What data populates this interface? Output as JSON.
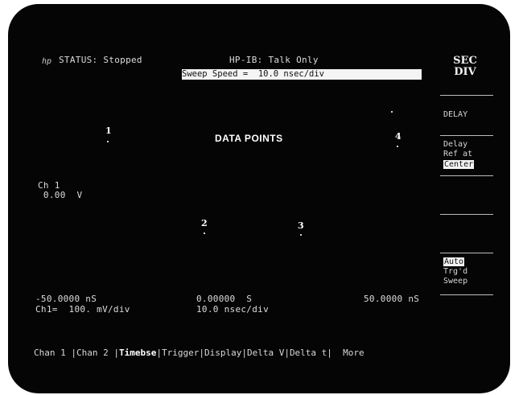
{
  "header": {
    "logo": "hp",
    "status": "STATUS: Stopped",
    "hpib": "HP-IB: Talk Only",
    "sweep_speed": "Sweep Speed =  10.0 nsec/div"
  },
  "softkeys": {
    "title_line1": "SEC",
    "title_line2": "DIV",
    "delay": "DELAY",
    "delay_ref_line1": "Delay",
    "delay_ref_line2": "Ref at",
    "delay_ref_line3": "Center",
    "mode_line1": "Auto",
    "mode_line2": "Trg'd",
    "mode_line3": "Sweep"
  },
  "overlay": {
    "title": "DATA POINTS",
    "markers": [
      "1",
      "2",
      "3",
      "4"
    ]
  },
  "channel": {
    "label": "Ch 1",
    "offset": " 0.00  V"
  },
  "timebase": {
    "left": "-50.0000 nS",
    "center": "0.00000  S",
    "right": "50.0000 nS",
    "ch1_scale": "Ch1=  100. mV/div",
    "time_scale": "10.0 nsec/div"
  },
  "menu": {
    "items": [
      "Chan 1",
      "Chan 2",
      "Timebse",
      "Trigger",
      "Display",
      "Delta V",
      "Delta t",
      "More"
    ]
  }
}
